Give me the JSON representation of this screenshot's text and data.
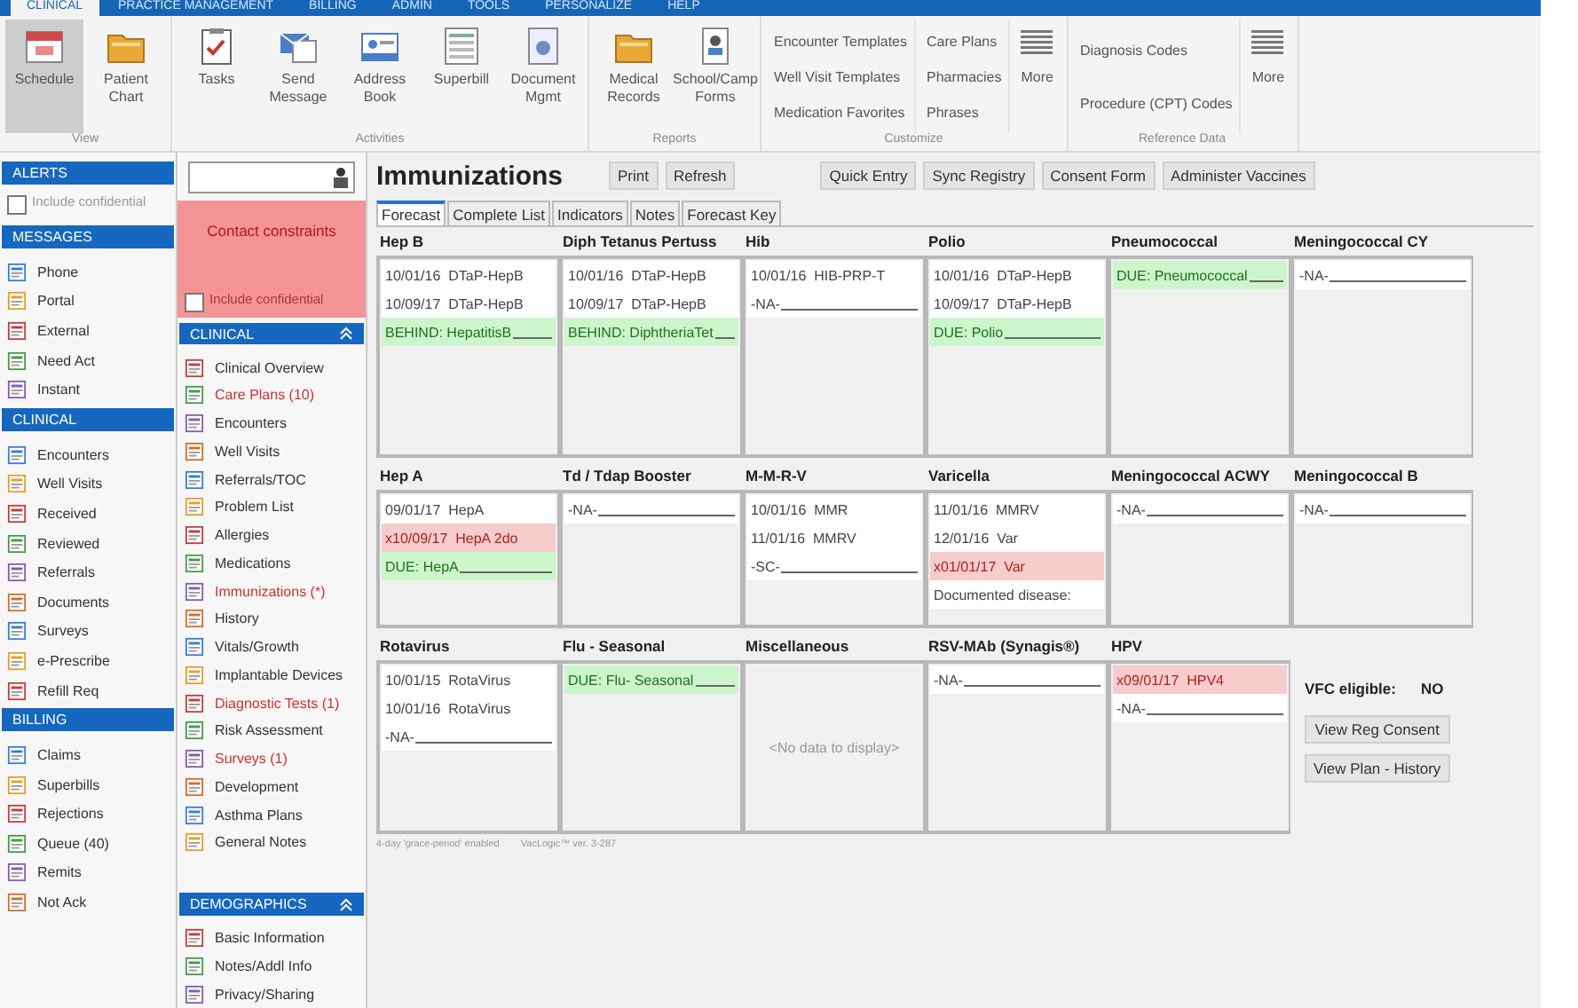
{
  "menu_tabs": [
    {
      "label": "CLINICAL",
      "selected": true
    },
    {
      "label": "PRACTICE MANAGEMENT",
      "selected": false
    },
    {
      "label": "BILLING",
      "selected": false
    },
    {
      "label": "ADMIN",
      "selected": false
    },
    {
      "label": "TOOLS",
      "selected": false
    },
    {
      "label": "PERSONALIZE",
      "selected": false
    },
    {
      "label": "HELP",
      "selected": false
    }
  ],
  "ribbon": [
    {
      "kind": "large",
      "label": "View",
      "buttons": [
        {
          "label": "Schedule",
          "selected": true
        },
        {
          "label": "Patient Chart",
          "selected": false
        }
      ]
    },
    {
      "kind": "large",
      "label": "Activities",
      "buttons": [
        {
          "label": "Tasks",
          "selected": false
        },
        {
          "label": "Send Message",
          "selected": false
        },
        {
          "label": "Address Book",
          "selected": false
        },
        {
          "label": "Superbill",
          "selected": false
        },
        {
          "label": "Document Mgmt",
          "selected": false
        }
      ]
    },
    {
      "kind": "large",
      "label": "Reports",
      "buttons": [
        {
          "label": "Medical Records",
          "selected": false
        },
        {
          "label": "School/Camp Forms",
          "selected": false
        }
      ]
    },
    {
      "kind": "links",
      "label": "Customize",
      "columns": [
        [
          "Encounter Templates",
          "Well Visit Templates",
          "Medication Favorites"
        ],
        [
          "Care Plans",
          "Pharmacies",
          "Phrases"
        ]
      ],
      "more": "More"
    },
    {
      "kind": "links",
      "label": "Reference Data",
      "columns": [
        [
          "Diagnosis Codes",
          "Procedure (CPT) Codes"
        ]
      ],
      "more": "More"
    }
  ],
  "alerts": {
    "title": "ALERTS",
    "include": {
      "label": "Include confidential",
      "checked": false
    }
  },
  "left_sections": [
    {
      "title": "MESSAGES",
      "items": [
        "Phone",
        "Portal",
        "External",
        "Need Act",
        "Instant"
      ]
    },
    {
      "title": "CLINICAL",
      "items": [
        "Encounters",
        "Well Visits",
        "Received",
        "Reviewed",
        "Referrals",
        "Documents",
        "Surveys",
        "e-Prescribe",
        "Refill Req"
      ]
    },
    {
      "title": "BILLING",
      "items": [
        "Claims",
        "Superbills",
        "Rejections",
        "Queue (40)",
        "Remits",
        "Not Ack"
      ]
    }
  ],
  "contact": {
    "text": "Contact constraints",
    "include": {
      "label": "Include confidential",
      "checked": false
    }
  },
  "chart_sections": [
    {
      "title": "CLINICAL",
      "items": [
        {
          "label": "Clinical Overview",
          "alert": false
        },
        {
          "label": "Care Plans (10)",
          "alert": true
        },
        {
          "label": "Encounters",
          "alert": false
        },
        {
          "label": "Well Visits",
          "alert": false
        },
        {
          "label": "Referrals/TOC",
          "alert": false
        },
        {
          "label": "Problem List",
          "alert": false
        },
        {
          "label": "Allergies",
          "alert": false
        },
        {
          "label": "Medications",
          "alert": false
        },
        {
          "label": "Immunizations (*)",
          "alert": true
        },
        {
          "label": "History",
          "alert": false
        },
        {
          "label": "Vitals/Growth",
          "alert": false
        },
        {
          "label": "Implantable Devices",
          "alert": false
        },
        {
          "label": "Diagnostic Tests (1)",
          "alert": true
        },
        {
          "label": "Risk Assessment",
          "alert": false
        },
        {
          "label": "Surveys (1)",
          "alert": true
        },
        {
          "label": "Development",
          "alert": false
        },
        {
          "label": "Asthma Plans",
          "alert": false
        },
        {
          "label": "General Notes",
          "alert": false
        }
      ]
    },
    {
      "title": "DEMOGRAPHICS",
      "items": [
        {
          "label": "Basic Information",
          "alert": false
        },
        {
          "label": "Notes/Addl Info",
          "alert": false
        },
        {
          "label": "Privacy/Sharing",
          "alert": false
        }
      ]
    }
  ],
  "main": {
    "title": "Immunizations",
    "buttons_left": [
      "Print",
      "Refresh"
    ],
    "buttons_right": [
      "Quick Entry",
      "Sync Registry",
      "Consent Form",
      "Administer Vaccines"
    ],
    "tabs": [
      {
        "label": "Forecast",
        "selected": true
      },
      {
        "label": "Complete List",
        "selected": false
      },
      {
        "label": "Indicators",
        "selected": false
      },
      {
        "label": "Notes",
        "selected": false
      },
      {
        "label": "Forecast Key",
        "selected": false
      }
    ],
    "vaccine_rows": [
      [
        {
          "name": "Hep B",
          "entries": [
            {
              "text": "10/01/16  DTaP-HepB",
              "kind": "given"
            },
            {
              "text": "10/09/17  DTaP-HepB",
              "kind": "given"
            },
            {
              "text": "BEHIND: HepatitisB",
              "kind": "due"
            }
          ]
        },
        {
          "name": "Diph Tetanus Pertuss",
          "entries": [
            {
              "text": "10/01/16  DTaP-HepB",
              "kind": "given"
            },
            {
              "text": "10/09/17  DTaP-HepB",
              "kind": "given"
            },
            {
              "text": "BEHIND: DiphtheriaTet",
              "kind": "due"
            }
          ]
        },
        {
          "name": "Hib",
          "entries": [
            {
              "text": "10/01/16  HIB-PRP-T",
              "kind": "given"
            },
            {
              "text": "-NA-",
              "kind": "na"
            }
          ]
        },
        {
          "name": "Polio",
          "entries": [
            {
              "text": "10/01/16  DTaP-HepB",
              "kind": "given"
            },
            {
              "text": "10/09/17  DTaP-HepB",
              "kind": "given"
            },
            {
              "text": "DUE: Polio",
              "kind": "due"
            }
          ]
        },
        {
          "name": "Pneumococcal",
          "entries": [
            {
              "text": "DUE: Pneumococcal",
              "kind": "due"
            }
          ]
        },
        {
          "name": "Meningococcal CY",
          "entries": [
            {
              "text": "-NA-",
              "kind": "na"
            }
          ]
        }
      ],
      [
        {
          "name": "Hep A",
          "entries": [
            {
              "text": "09/01/17  HepA",
              "kind": "given"
            },
            {
              "text": "x10/09/17  HepA 2do",
              "kind": "missed"
            },
            {
              "text": "DUE: HepA",
              "kind": "due"
            }
          ]
        },
        {
          "name": "Td / Tdap Booster",
          "entries": [
            {
              "text": "-NA-",
              "kind": "na"
            }
          ]
        },
        {
          "name": "M-M-R-V",
          "entries": [
            {
              "text": "10/01/16  MMR",
              "kind": "given"
            },
            {
              "text": "11/01/16  MMRV",
              "kind": "given"
            },
            {
              "text": "-SC-",
              "kind": "na"
            }
          ]
        },
        {
          "name": "Varicella",
          "entries": [
            {
              "text": "11/01/16  MMRV",
              "kind": "given"
            },
            {
              "text": "12/01/16  Var",
              "kind": "given"
            },
            {
              "text": "x01/01/17  Var",
              "kind": "missed"
            },
            {
              "text": "Documented disease:",
              "kind": "given"
            }
          ]
        },
        {
          "name": "Meningococcal ACWY",
          "entries": [
            {
              "text": "-NA-",
              "kind": "na"
            }
          ]
        },
        {
          "name": "Meningococcal B",
          "entries": [
            {
              "text": "-NA-",
              "kind": "na"
            }
          ]
        }
      ],
      [
        {
          "name": "Rotavirus",
          "entries": [
            {
              "text": "10/01/15  RotaVirus",
              "kind": "given"
            },
            {
              "text": "10/01/16  RotaVirus",
              "kind": "given"
            },
            {
              "text": "-NA-",
              "kind": "na"
            }
          ]
        },
        {
          "name": "Flu - Seasonal",
          "entries": [
            {
              "text": "DUE: Flu- Seasonal",
              "kind": "due"
            }
          ]
        },
        {
          "name": "Miscellaneous",
          "empty_message": "<No data to display>"
        },
        {
          "name": "RSV-MAb (Synagis®)",
          "entries": [
            {
              "text": "-NA-",
              "kind": "na"
            }
          ]
        },
        {
          "name": "HPV",
          "entries": [
            {
              "text": "x09/01/17  HPV4",
              "kind": "missed"
            },
            {
              "text": "-NA-",
              "kind": "na"
            }
          ]
        }
      ]
    ],
    "vfc": {
      "label": "VFC eligible:",
      "value": "NO"
    },
    "side_buttons": [
      "View Reg Consent",
      "View Plan - History"
    ],
    "footer": [
      "4-day 'grace-period' enabled",
      "VacLogic™  ver. 3-287"
    ]
  }
}
